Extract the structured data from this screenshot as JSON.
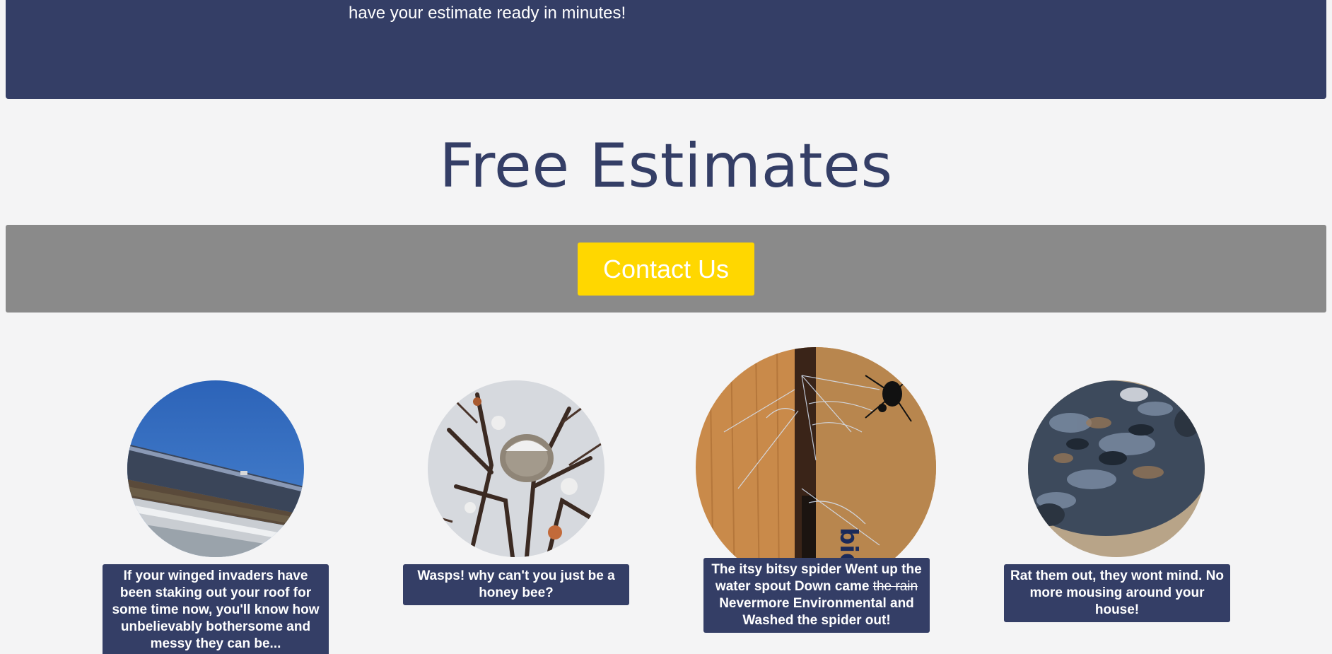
{
  "banner": {
    "text": "have your estimate ready in minutes!"
  },
  "section": {
    "title": "Free Estimates"
  },
  "cta": {
    "label": "Contact Us",
    "color": "#ffd700"
  },
  "cards": [
    {
      "image_icon": "roof-gutter-photo",
      "caption": "If your winged invaders have been staking out your roof for some time now, you'll know how unbelievably bothersome and messy they can be..."
    },
    {
      "image_icon": "wasp-nest-photo",
      "caption": "Wasps! why can't you just be a honey bee?"
    },
    {
      "image_icon": "spider-web-photo",
      "caption_before": "The itsy bitsy spider Went up the water spout Down came",
      "caption_struck": "the rain",
      "caption_after": "Nevermore Environmental and Washed the spider out!"
    },
    {
      "image_icon": "rat-fur-photo",
      "caption": "Rat them out, they wont mind. No more mousing around your house!"
    }
  ],
  "colors": {
    "navy": "#343e66",
    "gray_band": "#8a8a8a",
    "background": "#f4f4f5"
  }
}
